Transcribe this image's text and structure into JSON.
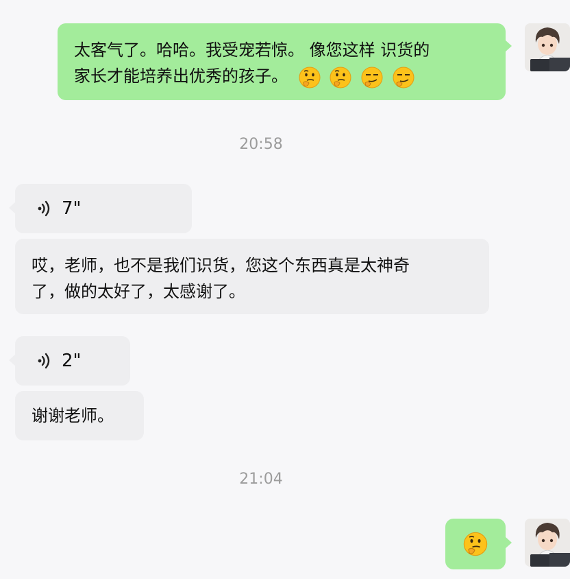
{
  "messages": [
    {
      "side": "right",
      "text_line1": "太客气了。哈哈。我受宠若惊。 像您这样 识货的",
      "text_line2": "家长才能培养出优秀的孩子。",
      "emojis": [
        "thinking-face",
        "thinking-face",
        "smirk-face",
        "smirk-face"
      ]
    },
    {
      "timestamp": "20:58"
    },
    {
      "side": "left",
      "voice_duration": "7\""
    },
    {
      "side": "left",
      "text_line1": "哎，老师，也不是我们识货，您这个东西真是太神奇",
      "text_line2": "了，做的太好了，太感谢了。"
    },
    {
      "side": "left",
      "voice_duration": "2\""
    },
    {
      "side": "left",
      "text": "谢谢老师。"
    },
    {
      "timestamp": "21:04"
    },
    {
      "side": "right",
      "emojis": [
        "thinking-face"
      ]
    }
  ]
}
